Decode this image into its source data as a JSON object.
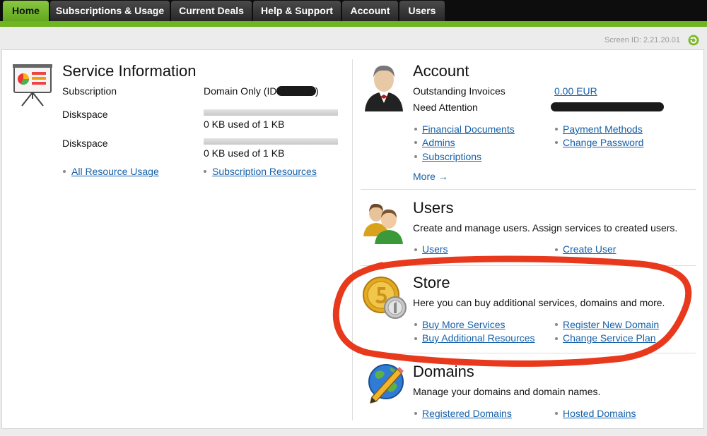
{
  "nav": {
    "tabs": [
      "Home",
      "Subscriptions & Usage",
      "Current Deals",
      "Help & Support",
      "Account",
      "Users"
    ],
    "active": "Home"
  },
  "screen_id": "Screen ID:  2.21.20.01",
  "service": {
    "title": "Service Information",
    "subscription_label": "Subscription",
    "subscription_value": "Domain Only (ID:",
    "subscription_close": ")",
    "disk1_label": "Diskspace",
    "disk1_value": "0 KB used of 1 KB",
    "disk2_label": "Diskspace",
    "disk2_value": "0 KB used of 1 KB",
    "links": [
      "All Resource Usage",
      "Subscription Resources"
    ]
  },
  "account": {
    "title": "Account",
    "invoices_label": "Outstanding Invoices",
    "invoices_value": "0.00 EUR",
    "attention_label": "Need Attention",
    "links_left": [
      "Financial Documents",
      "Admins",
      "Subscriptions"
    ],
    "links_right": [
      "Payment Methods",
      "Change Password"
    ],
    "more": "More →"
  },
  "users": {
    "title": "Users",
    "desc": "Create and manage users. Assign services to created users.",
    "links": [
      "Users",
      "Create User"
    ]
  },
  "store": {
    "title": "Store",
    "desc": "Here you can buy additional services, domains and more.",
    "links_left": [
      "Buy More Services",
      "Buy Additional Resources"
    ],
    "links_right": [
      "Register New Domain",
      "Change Service Plan"
    ]
  },
  "domains": {
    "title": "Domains",
    "desc": "Manage your domains and domain names.",
    "links": [
      "Registered Domains",
      "Hosted Domains"
    ]
  },
  "colors": {
    "accent_green": "#6fb421",
    "link_blue": "#1560a8",
    "annotation_red": "#e8391d"
  }
}
